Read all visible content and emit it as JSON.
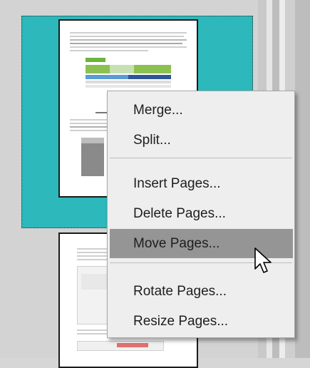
{
  "context_menu": {
    "items": [
      {
        "label": "Merge..."
      },
      {
        "label": "Split..."
      },
      {
        "label": "Insert Pages..."
      },
      {
        "label": "Delete Pages..."
      },
      {
        "label": "Move Pages...",
        "highlighted": true
      },
      {
        "label": "Rotate Pages..."
      },
      {
        "label": "Resize Pages..."
      }
    ]
  },
  "colors": {
    "selection": "#2db8bb",
    "highlight": "#959595",
    "menu_background": "#eeeeee"
  },
  "icons": [
    "arrow-cursor-icon"
  ]
}
